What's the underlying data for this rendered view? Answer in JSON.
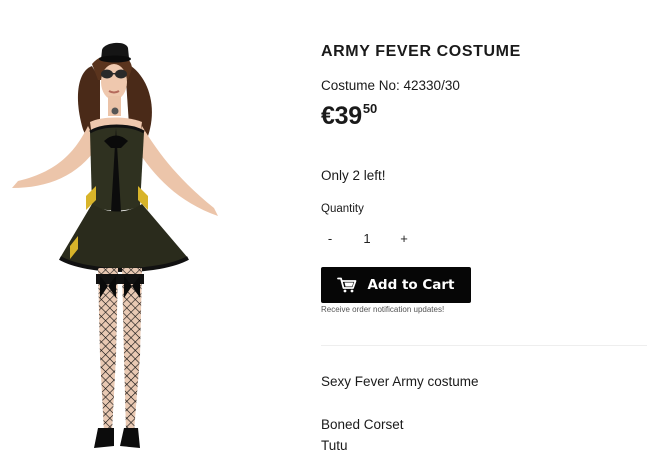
{
  "product": {
    "image_alt": "Army Fever costume model",
    "title": "ARMY FEVER COSTUME",
    "costume_number": "Costume No: 42330/30",
    "price": {
      "main": "€39",
      "cents": "50"
    },
    "stock_text": "Only 2 left!",
    "quantity": {
      "label": "Quantity",
      "value": "1",
      "decrement_label": "-",
      "increment_label": "+"
    },
    "add_to_cart": {
      "label": "Add to Cart",
      "icon": "cart-icon"
    },
    "notification_text": "Receive order notification updates!",
    "description": [
      "Sexy Fever Army costume",
      "Boned Corset",
      "Tutu"
    ]
  }
}
